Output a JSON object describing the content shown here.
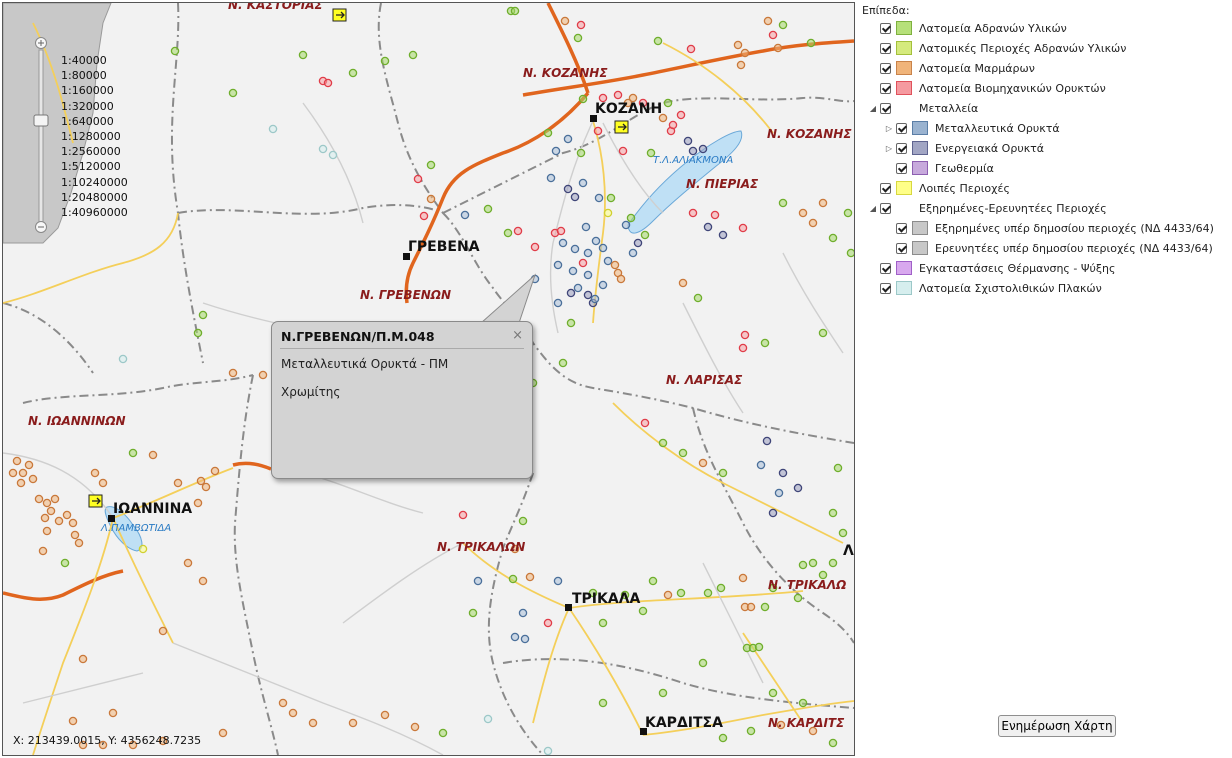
{
  "map": {
    "zoom_levels": [
      "1:40000",
      "1:80000",
      "1:160000",
      "1:320000",
      "1:640000",
      "1:1280000",
      "1:2560000",
      "1:5120000",
      "1:10240000",
      "1:20480000",
      "1:40960000"
    ],
    "coordinates": "X: 213439.0015, Y: 4356248.7235",
    "prefectures": [
      "Ν. ΚΑΣΤΟΡΙΑΣ",
      "Ν. ΚΟΖΑΝΗΣ",
      "Ν. ΚΟΖΑΝΗΣ",
      "Ν. ΠΙΕΡΙΑΣ",
      "Ν. ΓΡΕΒΕΝΩΝ",
      "Ν. ΛΑΡΙΣΑΣ",
      "Ν. ΙΩΑΝΝΙΝΩΝ",
      "Ν. ΤΡΙΚΑΛΩΝ",
      "Ν. ΤΡΙΚΑΛΩ",
      "Ν. ΚΑΡΔΙΤΣ"
    ],
    "cities": [
      "ΚΟΖΑΝΗ",
      "ΓΡΕΒΕΝΑ",
      "ΙΩΑΝΝΙΝΑ",
      "ΤΡΙΚΑΛΑ",
      "ΚΑΡΔΙΤΣΑ"
    ],
    "lakes": [
      "Τ.Λ.ΑΛΙΑΚΜΟΝΑ",
      "Λ.ΠΑΜΒΩΤΙΔΑ"
    ],
    "edge_letter": "Λ"
  },
  "popup": {
    "title": "Ν.ΓΡΕΒΕΝΩΝ/Π.Μ.048",
    "close": "×",
    "line1": "Μεταλλευτικά Ορυκτά - ΠΜ",
    "line2": "Χρωμίτης"
  },
  "legend": {
    "title": "Επίπεδα:",
    "items": [
      {
        "label": "Λατομεία Αδρανών Υλικών",
        "color": "#b6e07a",
        "border": "#7fb13f"
      },
      {
        "label": "Λατομικές Περιοχές Αδρανών Υλικών",
        "color": "#d5ea7d",
        "border": "#a4c03c"
      },
      {
        "label": "Λατομεία Μαρμάρων",
        "color": "#f0b47a",
        "border": "#c9834a"
      },
      {
        "label": "Λατομεία Βιομηχανικών Ορυκτών",
        "color": "#f59aa0",
        "border": "#e0525c"
      },
      {
        "label": "Μεταλλεία",
        "color": "",
        "border": ""
      },
      {
        "label": "Μεταλλευτικά Ορυκτά",
        "color": "#9ab3d0",
        "border": "#5b7ea6"
      },
      {
        "label": "Ενεργειακά Ορυκτά",
        "color": "#a2a6c4",
        "border": "#5f6490"
      },
      {
        "label": "Γεωθερμία",
        "color": "#c7a9dc",
        "border": "#8d5fb1"
      },
      {
        "label": "Λοιπές Περιοχές",
        "color": "#ffff88",
        "border": "#d8d840"
      },
      {
        "label": "Εξηρημένες-Ερευνητέες Περιοχές",
        "color": "",
        "border": ""
      },
      {
        "label": "Εξηρημένες υπέρ δημοσίου περιοχές (ΝΔ 4433/64)",
        "color": "#c8c8c8",
        "border": "#8c8c8c"
      },
      {
        "label": "Ερευνητέες υπέρ δημοσίου περιοχές (ΝΔ 4433/64)",
        "color": "#c8c8c8",
        "border": "#8c8c8c"
      },
      {
        "label": "Εγκαταστάσεις Θέρμανσης - Ψύξης",
        "color": "#d8a8ee",
        "border": "#a060c8"
      },
      {
        "label": "Λατομεία Σχιστολιθικών Πλακών",
        "color": "#d6eeee",
        "border": "#9cc8c8"
      }
    ]
  },
  "update_button": "Ενημέρωση Χάρτη"
}
